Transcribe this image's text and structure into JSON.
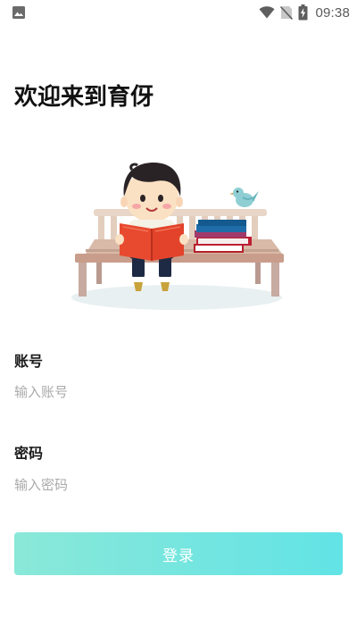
{
  "status_bar": {
    "time": "09:38",
    "left_icon": "image-icon",
    "icons": [
      "wifi-icon",
      "no-sim-icon",
      "battery-charging-icon"
    ]
  },
  "page": {
    "title": "欢迎来到育伢"
  },
  "form": {
    "account_label": "账号",
    "account_placeholder": "输入账号",
    "account_value": "",
    "password_label": "密码",
    "password_placeholder": "输入密码",
    "password_value": "",
    "login_label": "登录"
  },
  "colors": {
    "button_gradient_start": "#8ae8d8",
    "button_gradient_end": "#62e3e6",
    "title_color": "#111111",
    "placeholder_color": "#aaaaaa"
  }
}
